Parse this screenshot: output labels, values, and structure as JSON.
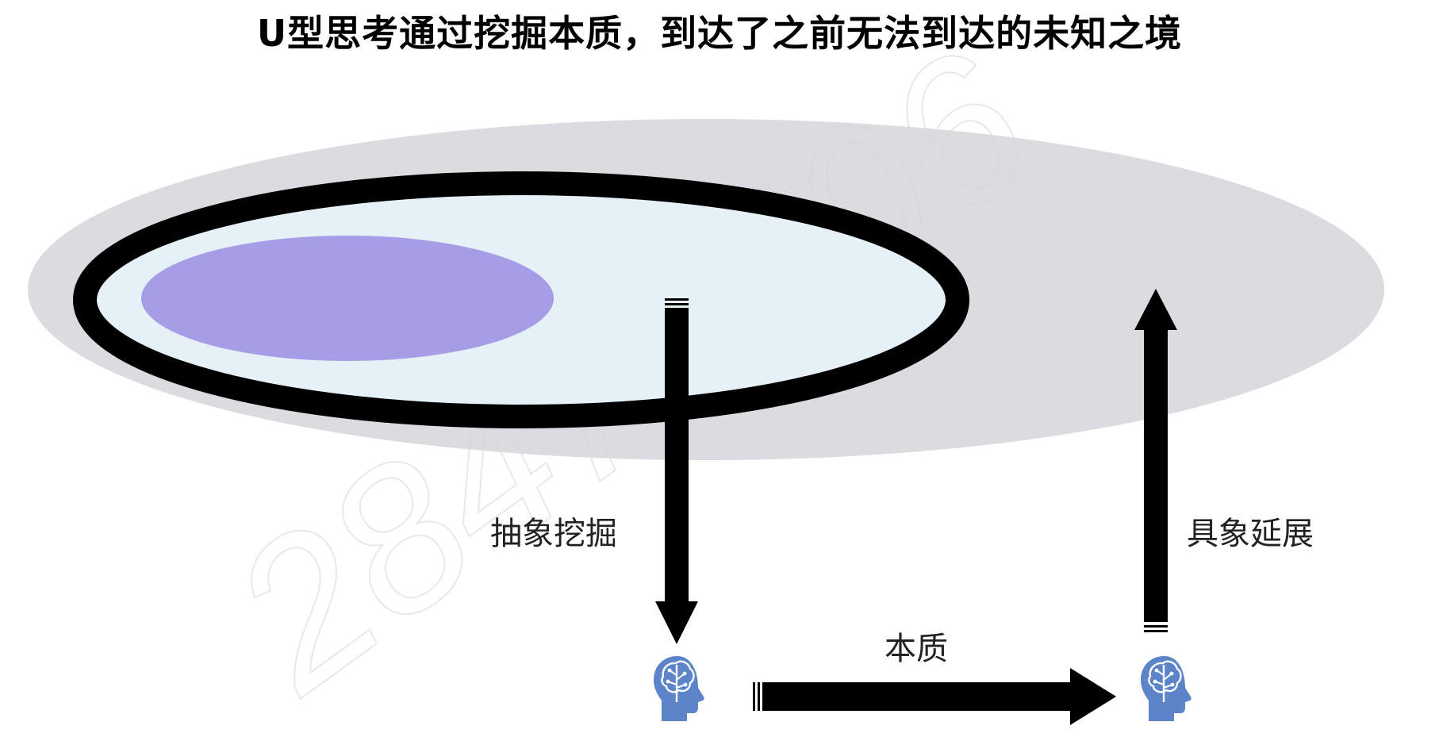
{
  "title": "U型思考通过挖掘本质，到达了之前无法到达的未知之境",
  "labels": {
    "abstract_dig": "抽象挖掘",
    "essence": "本质",
    "concrete_extend": "具象延展"
  },
  "watermark": "28471406",
  "colors": {
    "outer_region": "#dcdbdf",
    "ring_stroke": "#000000",
    "inner_region": "#e5f1f7",
    "core_region": "#a79de6",
    "arrow": "#000000",
    "head_icon": "#5b84c9"
  },
  "icons": {
    "left": "brain-head-icon",
    "right": "brain-head-icon"
  }
}
